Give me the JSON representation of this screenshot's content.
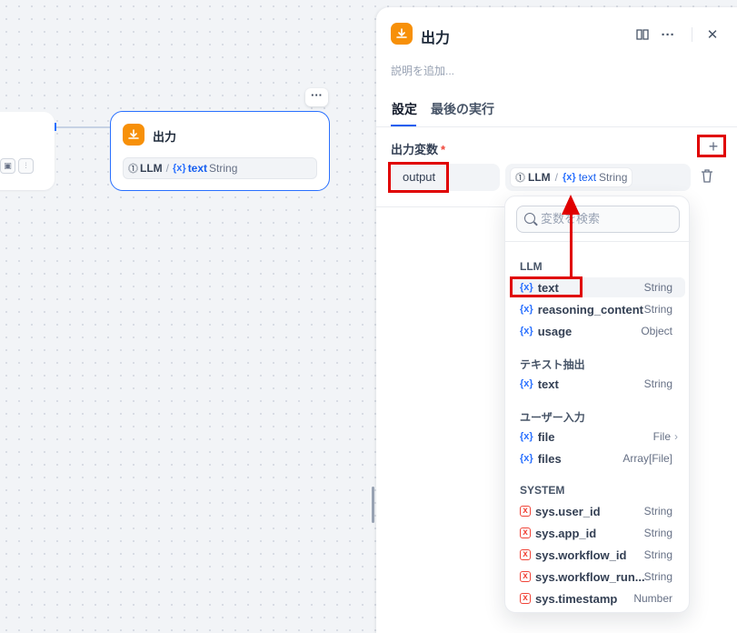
{
  "canvas": {
    "output_node": {
      "title": "出力",
      "chip_source": "LLM",
      "chip_sep": "/",
      "chip_icon": "{x}",
      "chip_var": "text",
      "chip_type": "String"
    },
    "node_menu": "···"
  },
  "panel": {
    "title": "出力",
    "description_placeholder": "説明を追加...",
    "tabs": [
      {
        "label": "設定",
        "active": true
      },
      {
        "label": "最後の実行",
        "active": false
      }
    ],
    "section_label": "出力変数",
    "required_mark": "*",
    "add_icon": "+",
    "output_row": {
      "name": "output",
      "value_source": "LLM",
      "value_sep": "/",
      "value_icon": "{x}",
      "value_var": "text",
      "value_type": "String"
    },
    "header_icons": [
      "book-icon",
      "more-icon",
      "close-icon"
    ]
  },
  "dropdown": {
    "search_placeholder": "変数を検索",
    "groups": [
      {
        "label": "LLM",
        "items": [
          {
            "name": "text",
            "type": "String"
          },
          {
            "name": "reasoning_content",
            "type": "String"
          },
          {
            "name": "usage",
            "type": "Object"
          }
        ]
      },
      {
        "label": "テキスト抽出",
        "items": [
          {
            "name": "text",
            "type": "String"
          }
        ]
      },
      {
        "label": "ユーザー入力",
        "items": [
          {
            "name": "file",
            "type": "File"
          },
          {
            "name": "files",
            "type": "Array[File]"
          }
        ]
      },
      {
        "label": "SYSTEM",
        "items": [
          {
            "name": "sys.user_id",
            "type": "String"
          },
          {
            "name": "sys.app_id",
            "type": "String"
          },
          {
            "name": "sys.workflow_id",
            "type": "String"
          },
          {
            "name": "sys.workflow_run...",
            "type": "String"
          },
          {
            "name": "sys.timestamp",
            "type": "Number"
          }
        ]
      }
    ],
    "var_icon": "{x}",
    "sys_icon": "x",
    "chevron": "›"
  },
  "colors": {
    "accent": "#155eef",
    "node_icon": "#f79009",
    "annotation": "#e00000",
    "system": "#f04438"
  }
}
